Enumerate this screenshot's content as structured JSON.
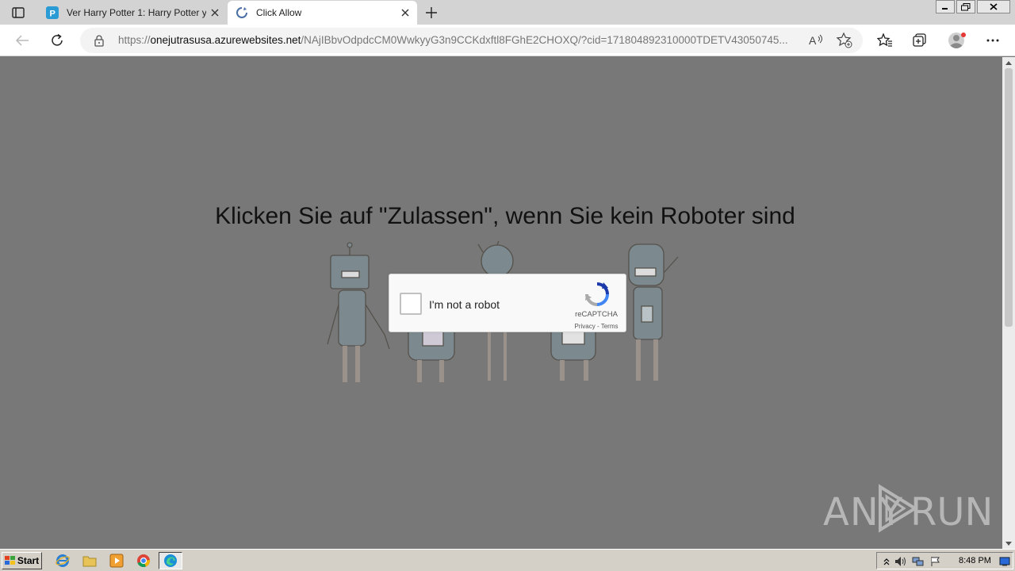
{
  "browser": {
    "tabs": [
      {
        "title": "Ver Harry Potter 1: Harry Potter y",
        "favicon": "p-letter-icon",
        "active": false
      },
      {
        "title": "Click Allow",
        "favicon": "loading-icon",
        "active": true
      }
    ],
    "address": {
      "prefix": "https://",
      "host": "onejutrasusa.azurewebsites.net",
      "path": "/NAjIBbvOdpdcCM0WwkyyG3n9CCKdxftl8FGhE2CHOXQ/?cid=171804892310000TDETV43050745..."
    }
  },
  "page": {
    "headline": "Klicken Sie auf \"Zulassen\", wenn Sie kein Roboter sind",
    "captcha": {
      "label": "I'm not a robot",
      "brand": "reCAPTCHA",
      "links": "Privacy - Terms"
    },
    "watermark": {
      "left": "ANY",
      "right": "RUN"
    }
  },
  "taskbar": {
    "start_label": "Start",
    "clock": "8:48 PM"
  },
  "colors": {
    "page_bg": "#787878",
    "accent_blue": "#1a73e8"
  }
}
